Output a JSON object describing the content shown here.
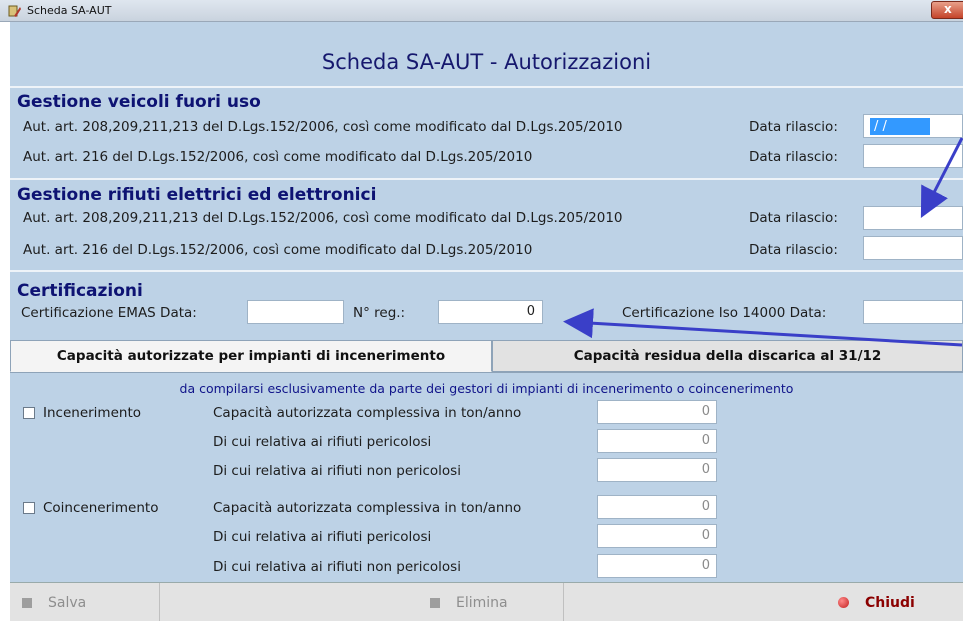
{
  "window": {
    "title": "Scheda SA-AUT",
    "close_label": "x"
  },
  "header": {
    "title": "Scheda SA-AUT - Autorizzazioni"
  },
  "veicoli": {
    "title": "Gestione veicoli fuori uso",
    "row1_label": "Aut. art. 208,209,211,213 del D.Lgs.152/2006, così come modificato dal D.Lgs.205/2010",
    "row1_date_label": "Data rilascio:",
    "row1_date_value": " /  /",
    "row2_label": "Aut. art. 216 del D.Lgs.152/2006, così come modificato dal D.Lgs.205/2010",
    "row2_date_label": "Data rilascio:"
  },
  "rifiuti": {
    "title": "Gestione rifiuti elettrici ed elettronici",
    "row1_label": "Aut. art. 208,209,211,213 del D.Lgs.152/2006, così come modificato dal D.Lgs.205/2010",
    "row1_date_label": "Data rilascio:",
    "row2_label": "Aut. art. 216 del D.Lgs.152/2006, così come modificato dal D.Lgs.205/2010",
    "row2_date_label": "Data rilascio:"
  },
  "certificazioni": {
    "title": "Certificazioni",
    "emas_label": "Certificazione EMAS  Data:",
    "nreg_label": "N° reg.:",
    "nreg_value": "0",
    "iso_label": "Certificazione Iso 14000  Data:"
  },
  "tabs": [
    {
      "label": "Capacità autorizzate per impianti di incenerimento"
    },
    {
      "label": "Capacità residua della discarica al 31/12"
    }
  ],
  "panel": {
    "note": "da compilarsi esclusivamente da parte dei gestori di impianti di incenerimento o coincenerimento",
    "groups": [
      {
        "checkbox_label": "Incenerimento",
        "rows": [
          {
            "label": "Capacità autorizzata complessiva in ton/anno",
            "value": "0"
          },
          {
            "label": "Di cui relativa ai rifiuti pericolosi",
            "value": "0"
          },
          {
            "label": "Di cui relativa ai rifiuti non pericolosi",
            "value": "0"
          }
        ]
      },
      {
        "checkbox_label": "Coincenerimento",
        "rows": [
          {
            "label": "Capacità autorizzata complessiva in ton/anno",
            "value": "0"
          },
          {
            "label": "Di cui relativa ai rifiuti pericolosi",
            "value": "0"
          },
          {
            "label": "Di cui relativa ai rifiuti non pericolosi",
            "value": "0"
          }
        ]
      }
    ]
  },
  "footer": {
    "save_label": "Salva",
    "delete_label": "Elimina",
    "close_label": "Chiudi"
  },
  "colors": {
    "panel_bg": "#bdd2e6",
    "title_blue": "#0e1373",
    "arrow_blue": "#3a3fc8",
    "selection": "#3399ff"
  }
}
